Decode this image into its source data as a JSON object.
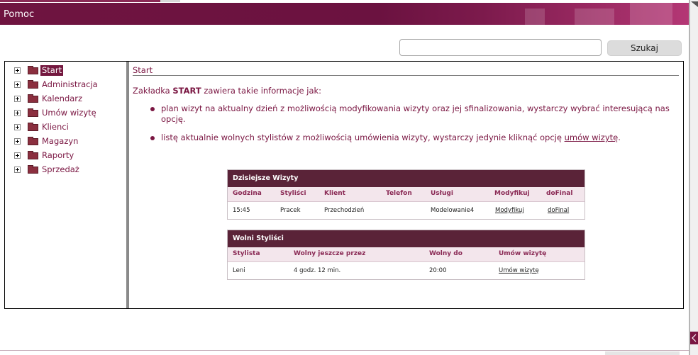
{
  "window": {
    "title": "Pomoc"
  },
  "search": {
    "button_label": "Szukaj",
    "value": ""
  },
  "sidebar": {
    "items": [
      {
        "label": "Start",
        "active": true
      },
      {
        "label": "Administracja"
      },
      {
        "label": "Kalendarz"
      },
      {
        "label": "Umów wizytę"
      },
      {
        "label": "Klienci"
      },
      {
        "label": "Magazyn"
      },
      {
        "label": "Raporty"
      },
      {
        "label": "Sprzedaż"
      }
    ]
  },
  "content": {
    "heading": "Start",
    "intro_prefix": "Zakładka ",
    "intro_bold": "START",
    "intro_suffix": " zawiera takie informacje jak:",
    "bullet1": "plan wizyt na aktualny dzień z możliwością modyfikowania wizyty oraz jej sfinalizowania, wystarczy wybrać interesującą nas opcję.",
    "bullet2_prefix": "listę aktualnie wolnych stylistów z możliwością umówienia wizyty, wystarczy jedynie kliknąć opcję ",
    "bullet2_link": "umów wizytę",
    "bullet2_suffix": "."
  },
  "table_visits": {
    "title": "Dzisiejsze Wizyty",
    "columns": [
      "Godzina",
      "Styliści",
      "Klient",
      "Telefon",
      "Usługi",
      "Modyfikuj",
      "doFinal"
    ],
    "row": {
      "godzina": "15:45",
      "stylisci": "Pracek",
      "klient": "Przechodzień",
      "telefon": "",
      "uslugi": "Modelowanie4",
      "modyfikuj": "Modyfikuj",
      "dofinal": "doFinal"
    }
  },
  "table_free": {
    "title": "Wolni Styliści",
    "columns": [
      "Stylista",
      "Wolny jeszcze przez",
      "Wolny do",
      "Umów wizytę"
    ],
    "row": {
      "stylista": "Leni",
      "wolny_przez": "4 godz. 12 min.",
      "wolny_do": "20:00",
      "umow": "Umów wizytę"
    }
  },
  "colors": {
    "accent": "#74183f",
    "title_bar": "#6f1440",
    "text": "#7a1642"
  }
}
